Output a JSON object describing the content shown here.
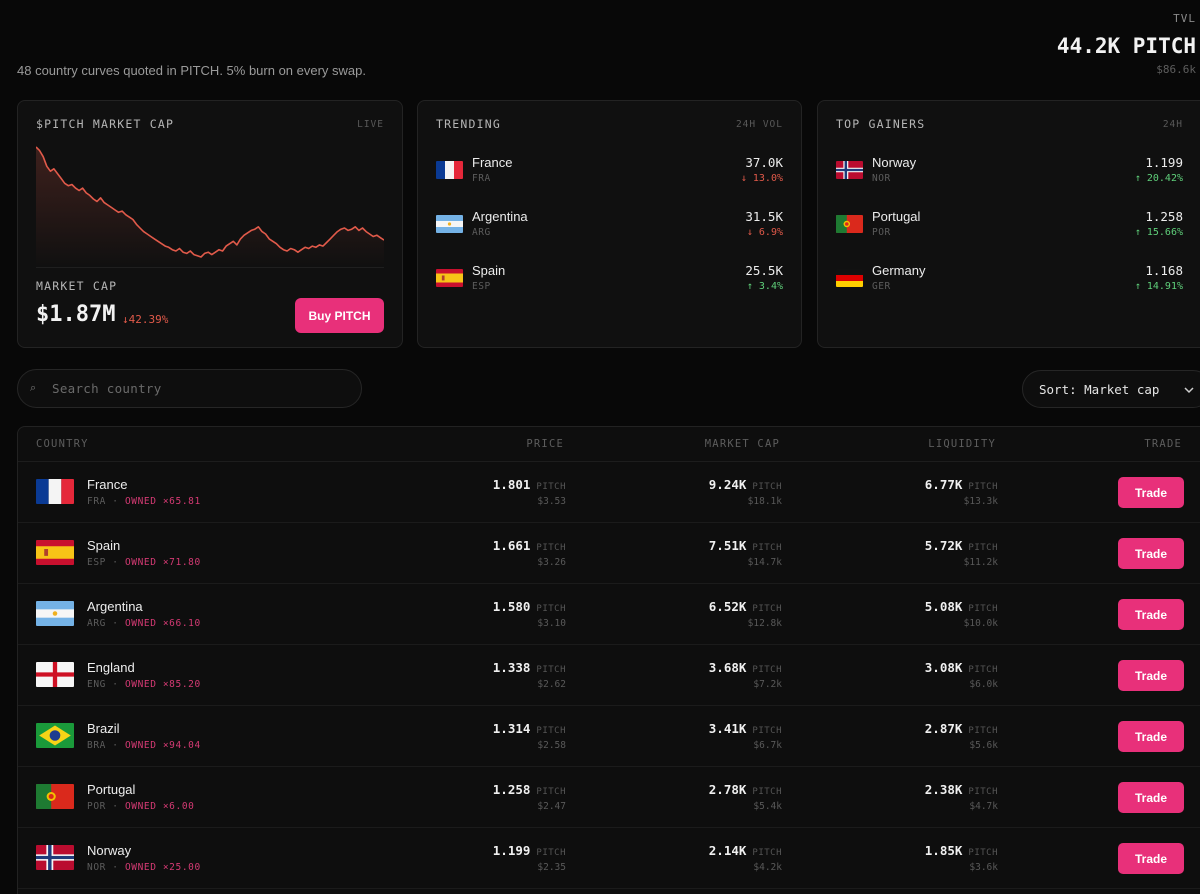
{
  "header": {
    "tagline": "48 country curves quoted in PITCH. 5% burn on every swap.",
    "tvl_label": "TVL",
    "tvl_value": "44.2K PITCH",
    "tvl_sub": "$86.6k"
  },
  "market_cap_card": {
    "title": "$PITCH MARKET CAP",
    "tag": "LIVE",
    "label": "MARKET CAP",
    "value": "$1.87M",
    "change": "↓42.39%",
    "buy_label": "Buy PITCH",
    "line_color": "#e15a4a",
    "chart_data": {
      "type": "line",
      "title": "",
      "values": [
        100,
        97,
        92,
        84,
        80,
        82,
        78,
        74,
        70,
        68,
        69,
        66,
        64,
        66,
        62,
        60,
        57,
        55,
        58,
        54,
        52,
        50,
        48,
        46,
        47,
        44,
        42,
        40,
        36,
        33,
        30,
        28,
        26,
        24,
        22,
        20,
        18,
        17,
        15,
        14,
        16,
        13,
        12,
        14,
        11,
        10,
        9,
        12,
        13,
        11,
        13,
        15,
        14,
        18,
        20,
        22,
        19,
        24,
        27,
        29,
        31,
        32,
        34,
        30,
        28,
        24,
        22,
        20,
        17,
        15,
        14,
        16,
        15,
        13,
        15,
        17,
        16,
        18,
        17,
        19,
        18,
        21,
        24,
        27,
        30,
        32,
        33,
        31,
        32,
        34,
        31,
        33,
        30,
        28,
        26,
        27,
        25,
        23
      ]
    }
  },
  "trending": {
    "title": "TRENDING",
    "tag": "24H VOL",
    "items": [
      {
        "name": "France",
        "code": "FRA",
        "value": "37.0K",
        "change": "↓ 13.0%",
        "dir": "down",
        "flag": "france"
      },
      {
        "name": "Argentina",
        "code": "ARG",
        "value": "31.5K",
        "change": "↓ 6.9%",
        "dir": "down",
        "flag": "argentina"
      },
      {
        "name": "Spain",
        "code": "ESP",
        "value": "25.5K",
        "change": "↑ 3.4%",
        "dir": "up",
        "flag": "spain"
      }
    ]
  },
  "gainers": {
    "title": "TOP GAINERS",
    "tag": "24H",
    "items": [
      {
        "name": "Norway",
        "code": "NOR",
        "value": "1.199",
        "change": "↑ 20.42%",
        "dir": "up",
        "flag": "norway"
      },
      {
        "name": "Portugal",
        "code": "POR",
        "value": "1.258",
        "change": "↑ 15.66%",
        "dir": "up",
        "flag": "portugal"
      },
      {
        "name": "Germany",
        "code": "GER",
        "value": "1.168",
        "change": "↑ 14.91%",
        "dir": "up",
        "flag": "germany"
      }
    ]
  },
  "search": {
    "placeholder": "Search country",
    "icon": "search-icon"
  },
  "sort": {
    "label": "Sort: Market cap"
  },
  "table": {
    "columns": {
      "country": "COUNTRY",
      "price": "PRICE",
      "market_cap": "MARKET CAP",
      "liquidity": "LIQUIDITY",
      "trade": "TRADE"
    },
    "unit": "PITCH",
    "trade_label": "Trade",
    "rows": [
      {
        "name": "France",
        "code": "FRA",
        "owned": "OWNED ×65.81",
        "price": "1.801",
        "price_usd": "$3.53",
        "mcap": "9.24K",
        "mcap_usd": "$18.1k",
        "liq": "6.77K",
        "liq_usd": "$13.3k",
        "flag": "france"
      },
      {
        "name": "Spain",
        "code": "ESP",
        "owned": "OWNED ×71.80",
        "price": "1.661",
        "price_usd": "$3.26",
        "mcap": "7.51K",
        "mcap_usd": "$14.7k",
        "liq": "5.72K",
        "liq_usd": "$11.2k",
        "flag": "spain"
      },
      {
        "name": "Argentina",
        "code": "ARG",
        "owned": "OWNED ×66.10",
        "price": "1.580",
        "price_usd": "$3.10",
        "mcap": "6.52K",
        "mcap_usd": "$12.8k",
        "liq": "5.08K",
        "liq_usd": "$10.0k",
        "flag": "argentina"
      },
      {
        "name": "England",
        "code": "ENG",
        "owned": "OWNED ×85.20",
        "price": "1.338",
        "price_usd": "$2.62",
        "mcap": "3.68K",
        "mcap_usd": "$7.2k",
        "liq": "3.08K",
        "liq_usd": "$6.0k",
        "flag": "england"
      },
      {
        "name": "Brazil",
        "code": "BRA",
        "owned": "OWNED ×94.04",
        "price": "1.314",
        "price_usd": "$2.58",
        "mcap": "3.41K",
        "mcap_usd": "$6.7k",
        "liq": "2.87K",
        "liq_usd": "$5.6k",
        "flag": "brazil"
      },
      {
        "name": "Portugal",
        "code": "POR",
        "owned": "OWNED ×6.00",
        "price": "1.258",
        "price_usd": "$2.47",
        "mcap": "2.78K",
        "mcap_usd": "$5.4k",
        "liq": "2.38K",
        "liq_usd": "$4.7k",
        "flag": "portugal"
      },
      {
        "name": "Norway",
        "code": "NOR",
        "owned": "OWNED ×25.00",
        "price": "1.199",
        "price_usd": "$2.35",
        "mcap": "2.14K",
        "mcap_usd": "$4.2k",
        "liq": "1.85K",
        "liq_usd": "$3.6k",
        "flag": "norway"
      }
    ]
  }
}
